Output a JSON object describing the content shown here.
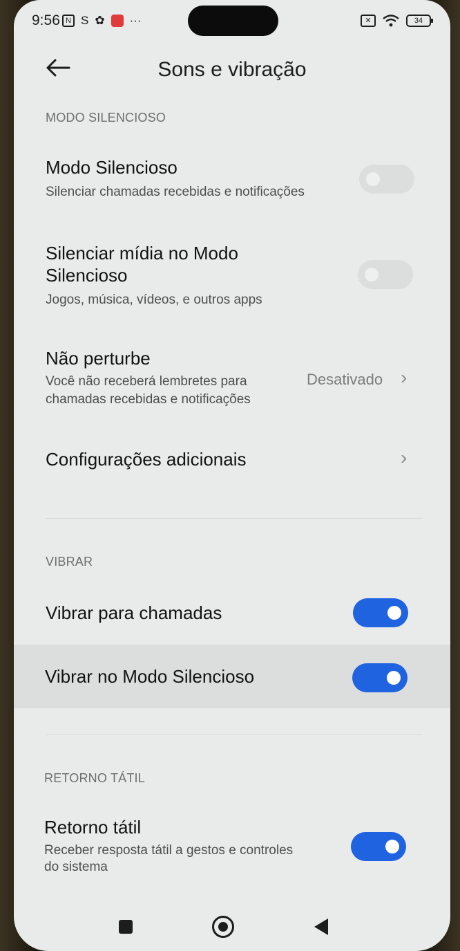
{
  "status_bar": {
    "time": "9:56",
    "icons_left": [
      "nfc-icon",
      "s-icon",
      "gear-icon",
      "mail-notification-icon",
      "more-dots-icon"
    ],
    "icons_right": [
      "sim-icon",
      "wifi-icon",
      "battery-icon"
    ],
    "battery_level": "34",
    "more_dots": "···"
  },
  "header": {
    "title": "Sons e vibração",
    "back_icon": "arrow-left-icon"
  },
  "sections": {
    "silent": {
      "label": "MODO SILENCIOSO",
      "silent_mode": {
        "title": "Modo Silencioso",
        "subtitle": "Silenciar chamadas recebidas e notificações",
        "enabled": false
      },
      "mute_media": {
        "title_line1": "Silenciar mídia no Modo",
        "title_line2": "Silencioso",
        "subtitle": "Jogos, música, vídeos, e outros apps",
        "enabled": false
      },
      "dnd": {
        "title": "Não perturbe",
        "subtitle_line1": "Você não receberá lembretes para",
        "subtitle_line2": "chamadas recebidas e notificações",
        "value": "Desativado"
      },
      "additional": {
        "title": "Configurações adicionais"
      }
    },
    "vibrate": {
      "label": "VIBRAR",
      "calls": {
        "title": "Vibrar para chamadas",
        "enabled": true
      },
      "silent_mode": {
        "title": "Vibrar no Modo Silencioso",
        "enabled": true
      }
    },
    "haptic": {
      "label": "RETORNO TÁTIL",
      "haptic_feedback": {
        "title": "Retorno tátil",
        "subtitle_line1": "Receber resposta tátil a gestos e controles",
        "subtitle_line2": "do sistema",
        "enabled": true
      }
    }
  },
  "colors": {
    "accent": "#1f63e0",
    "background": "#e9ebea",
    "toggle_off": "#dcdedd"
  },
  "glyphs": {
    "chevron": "›"
  }
}
